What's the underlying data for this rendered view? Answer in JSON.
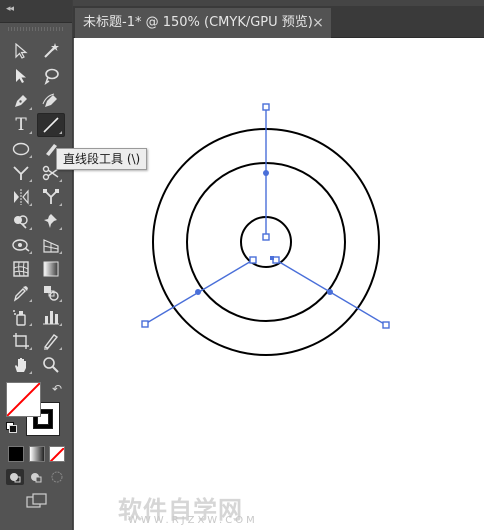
{
  "document_tab": {
    "title": "未标题-1* @ 150% (CMYK/GPU 预览)",
    "close_glyph": "×"
  },
  "toolbar": {
    "collapse_glyph": "◂◂",
    "tools": [
      {
        "name": "selection-tool",
        "icon": "arrow-outline-icon"
      },
      {
        "name": "magic-wand-tool",
        "icon": "magic-wand-icon"
      },
      {
        "name": "direct-selection-tool",
        "icon": "arrow-filled-icon"
      },
      {
        "name": "lasso-tool",
        "icon": "lasso-icon"
      },
      {
        "name": "pen-tool",
        "icon": "pen-icon"
      },
      {
        "name": "curvature-tool",
        "icon": "curvature-pen-icon"
      },
      {
        "name": "type-tool",
        "label": "T"
      },
      {
        "name": "line-segment-tool",
        "icon": "line-icon",
        "active": true
      },
      {
        "name": "ellipse-tool",
        "icon": "ellipse-icon"
      },
      {
        "name": "paintbrush-tool",
        "icon": "brush-icon"
      },
      {
        "name": "shaper-tool",
        "icon": "shaper-icon"
      },
      {
        "name": "scissors-tool",
        "icon": "scissors-icon"
      },
      {
        "name": "reflect-tool",
        "icon": "reflect-icon"
      },
      {
        "name": "free-transform-tool",
        "icon": "free-transform-icon"
      },
      {
        "name": "shape-builder-tool",
        "icon": "shape-builder-icon"
      },
      {
        "name": "pin-tool",
        "icon": "pin-icon"
      },
      {
        "name": "perspective-tool",
        "icon": "perspective-icon"
      },
      {
        "name": "mesh-tool",
        "icon": "mesh-icon"
      },
      {
        "name": "gradient-mesh-tool",
        "icon": "grid-icon"
      },
      {
        "name": "gradient-tool",
        "icon": "gradient-icon"
      },
      {
        "name": "eyedropper-tool",
        "icon": "eyedropper-icon"
      },
      {
        "name": "blend-tool",
        "icon": "blend-icon"
      },
      {
        "name": "symbol-sprayer-tool",
        "icon": "spray-icon"
      },
      {
        "name": "column-graph-tool",
        "icon": "bar-graph-icon"
      },
      {
        "name": "artboard-tool",
        "icon": "artboard-icon"
      },
      {
        "name": "slice-tool",
        "icon": "slice-icon"
      },
      {
        "name": "hand-tool",
        "icon": "hand-icon"
      },
      {
        "name": "zoom-tool",
        "icon": "magnifier-icon"
      }
    ],
    "tooltip": "直线段工具 (\\)"
  },
  "colors": {
    "fill": "#ffffff",
    "stroke": "#000000",
    "none_slash": "#ff0000",
    "selection": "#4a6fd9"
  },
  "watermark": {
    "main": "软件自学网",
    "sub": "WWW.RJZXW.COM"
  }
}
